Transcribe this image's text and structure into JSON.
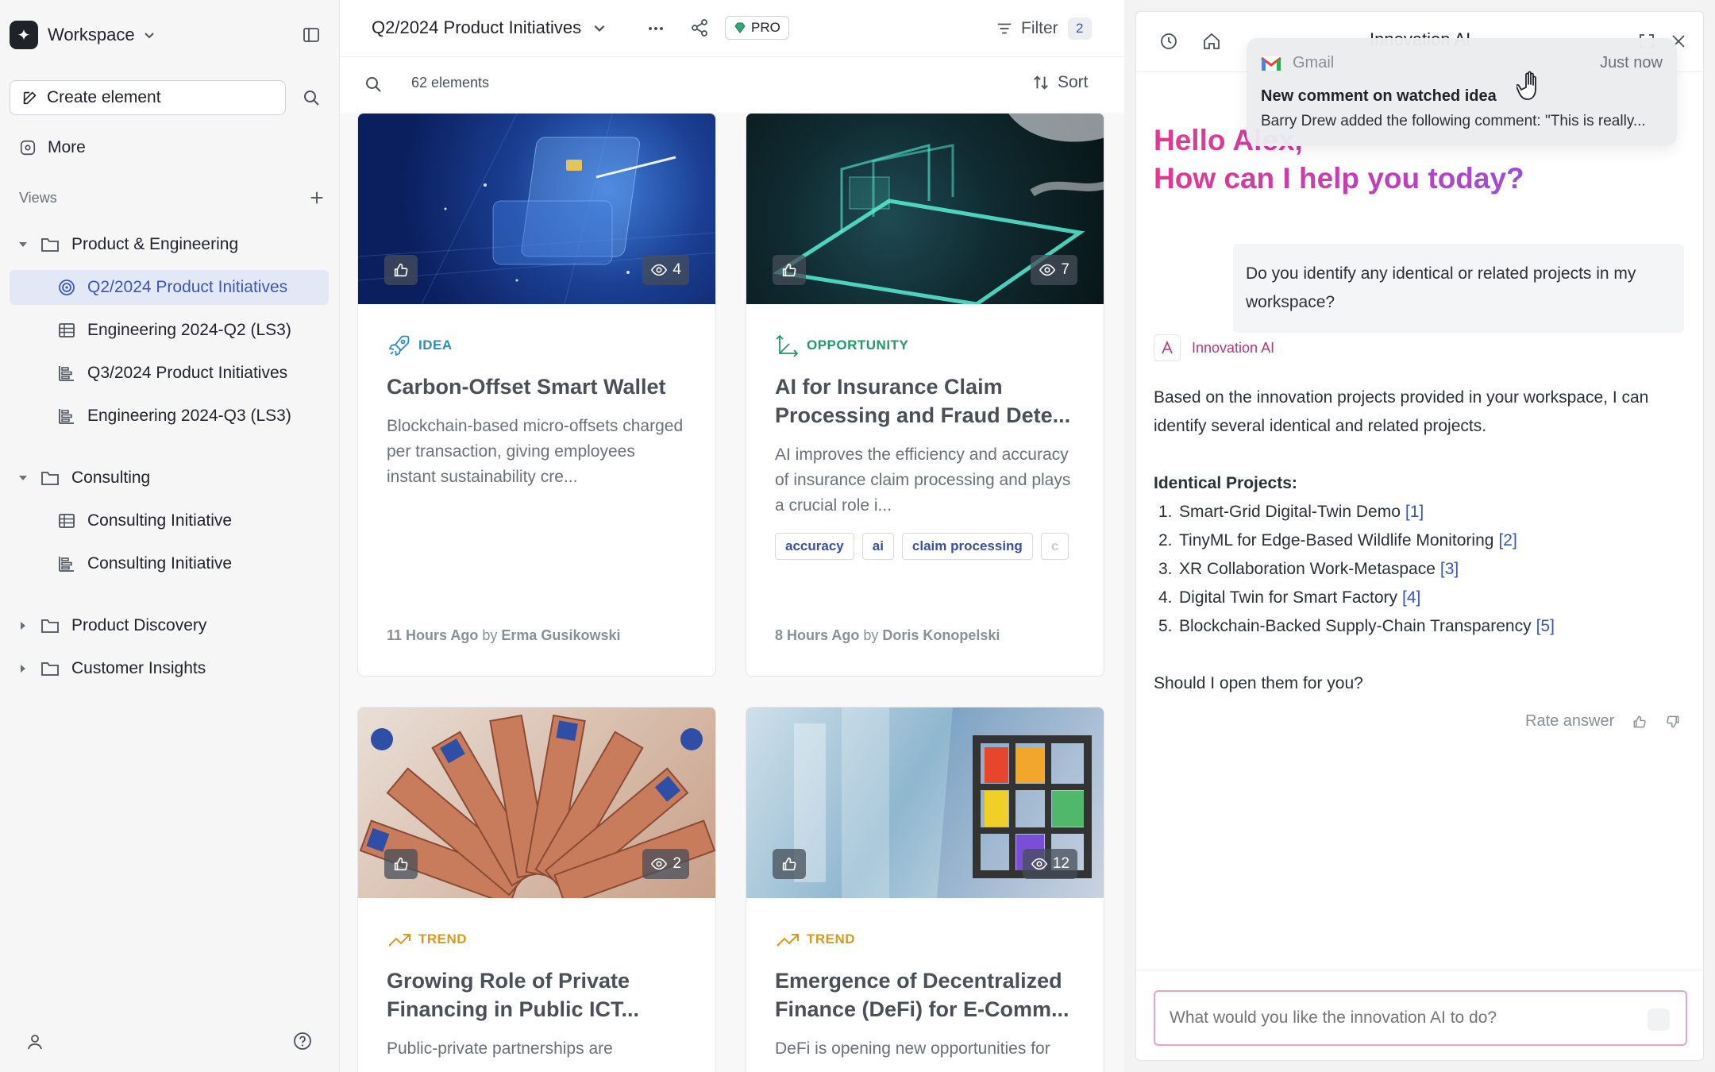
{
  "sidebar": {
    "workspace": "Workspace",
    "create_label": "Create element",
    "more_label": "More",
    "views_label": "Views",
    "groups": [
      {
        "label": "Product & Engineering",
        "expanded": true,
        "children": [
          {
            "label": "Q2/2024 Product Initiatives",
            "icon": "target-icon",
            "active": true
          },
          {
            "label": "Engineering 2024-Q2 (LS3)",
            "icon": "table-icon"
          },
          {
            "label": "Q3/2024 Product Initiatives",
            "icon": "timeline-icon"
          },
          {
            "label": "Engineering 2024-Q3 (LS3)",
            "icon": "timeline-icon"
          }
        ]
      },
      {
        "label": "Consulting",
        "expanded": true,
        "children": [
          {
            "label": "Consulting Initiative",
            "icon": "table-icon"
          },
          {
            "label": "Consulting Initiative",
            "icon": "timeline-icon"
          }
        ]
      },
      {
        "label": "Product Discovery",
        "expanded": false
      },
      {
        "label": "Customer Insights",
        "expanded": false
      }
    ]
  },
  "main": {
    "title": "Q2/2024 Product Initiatives",
    "pro": "PRO",
    "filter_label": "Filter",
    "filter_count": "2",
    "elements_count": "62 elements",
    "sort_label": "Sort",
    "cards": [
      {
        "type": "IDEA",
        "type_color": "#2a8fb8",
        "title": "Carbon-Offset Smart Wallet",
        "desc": "Blockchain-based micro-offsets charged per transaction, giving employees instant sustainability cre...",
        "views": "4",
        "time": "11 Hours Ago",
        "by": "by",
        "author": "Erma Gusikowski",
        "tags": []
      },
      {
        "type": "OPPORTUNITY",
        "type_color": "#1f9a6a",
        "title": "AI for Insurance Claim Processing and Fraud Dete...",
        "desc": "AI improves the efficiency and accuracy of insurance claim processing and plays a crucial role i...",
        "views": "7",
        "time": "8 Hours Ago",
        "by": "by",
        "author": "Doris Konopelski",
        "tags": [
          "accuracy",
          "ai",
          "claim processing",
          "c"
        ]
      },
      {
        "type": "TREND",
        "type_color": "#d99a1c",
        "title": "Growing Role of Private Financing in Public ICT...",
        "desc": "Public-private partnerships are",
        "views": "2"
      },
      {
        "type": "TREND",
        "type_color": "#d99a1c",
        "title": "Emergence of Decentralized Finance (DeFi) for E-Comm...",
        "desc": "DeFi is opening new opportunities for",
        "views": "12"
      }
    ]
  },
  "ai": {
    "title": "Innovation AI",
    "greeting_1": "Hello Alex,",
    "greeting_2": "How can I help you today?",
    "user_message": "Do you identify any identical or related projects in my workspace?",
    "sender": "Innovation AI",
    "intro": "Based on the innovation projects provided in your workspace, I can identify several identical and related projects.",
    "section": "Identical Projects:",
    "items": [
      {
        "n": "1.",
        "text": "Smart-Grid Digital-Twin Demo",
        "ref": "[1]"
      },
      {
        "n": "2.",
        "text": "TinyML for Edge-Based Wildlife Monitoring",
        "ref": "[2]"
      },
      {
        "n": "3.",
        "text": "XR Collaboration Work-Metaspace",
        "ref": "[3]"
      },
      {
        "n": "4.",
        "text": "Digital Twin for Smart Factory",
        "ref": "[4]"
      },
      {
        "n": "5.",
        "text": "Blockchain-Backed Supply-Chain Transparency",
        "ref": "[5]"
      }
    ],
    "closing": "Should I open them for you?",
    "rate_label": "Rate answer",
    "input_placeholder": "What would you like the innovation AI to do?"
  },
  "notification": {
    "app": "Gmail",
    "time": "Just now",
    "title": "New comment on watched idea",
    "body": "Barry Drew added the following comment: \"This is really..."
  }
}
